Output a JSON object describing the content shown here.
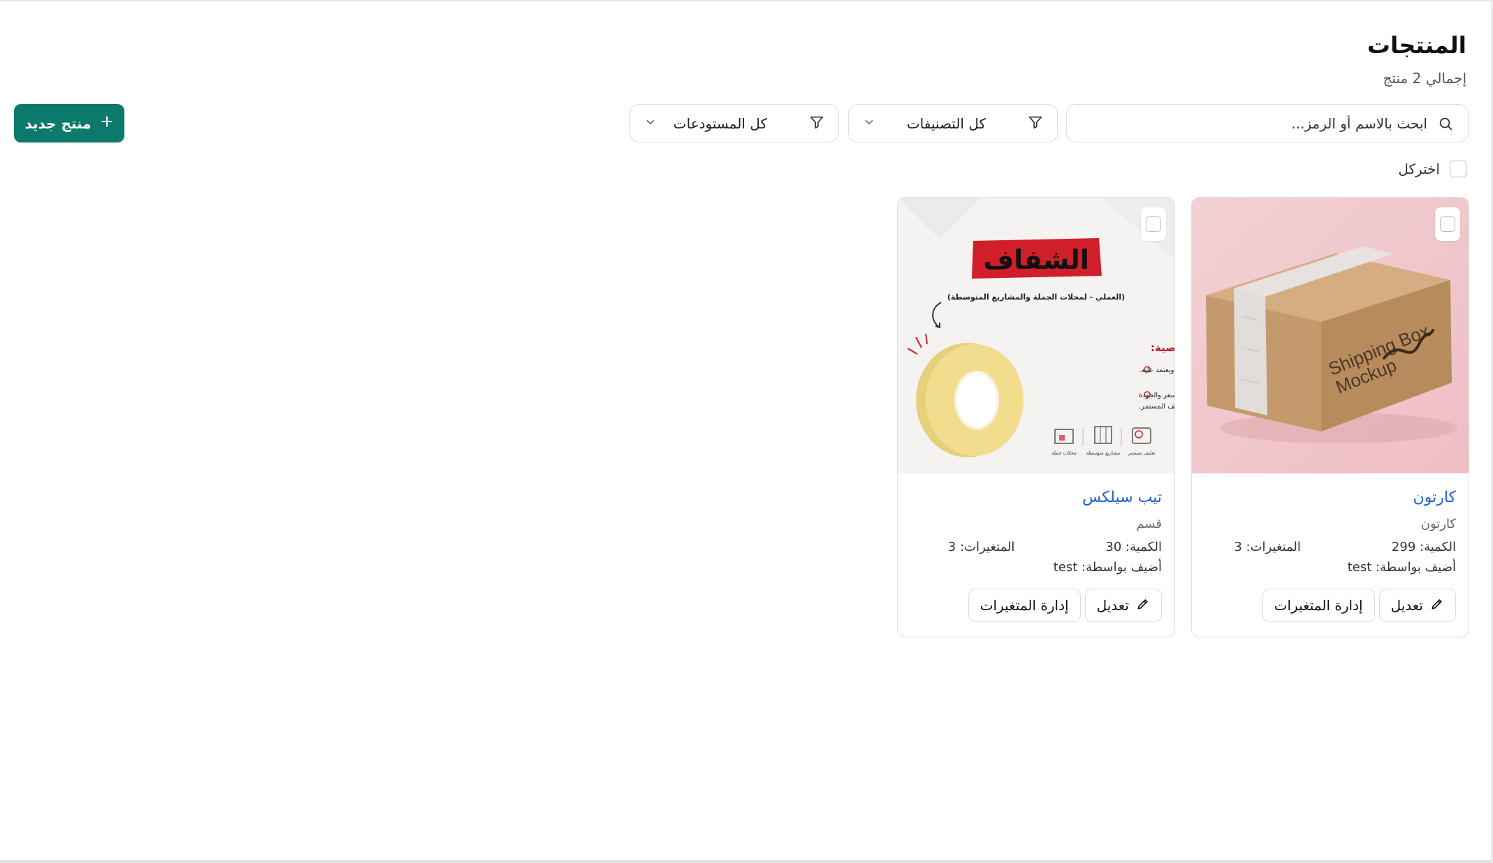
{
  "header": {
    "title": "المنتجات",
    "subtitle": "إجمالي 2 منتج"
  },
  "search": {
    "placeholder": "ابحث بالاسم أو الرمز...",
    "value": ""
  },
  "filters": {
    "categories": "كل التصنيفات",
    "warehouses": "كل المستودعات"
  },
  "new_product_button": "منتج جديد",
  "select_all_label": "اختركل",
  "labels": {
    "quantity": "الكمية:",
    "variants": "المتغيرات:",
    "added_by": "أضيف بواسطة:",
    "edit": "تعديل",
    "manage_variants": "إدارة المتغيرات"
  },
  "products": [
    {
      "name": "كارتون",
      "category": "كارتون",
      "quantity": "299",
      "variants": "3",
      "added_by": "test",
      "image_text": {
        "line1": "Shipping Box",
        "line2": "Mockup"
      }
    },
    {
      "name": "تيب سيلكس",
      "category": "قسم",
      "quantity": "30",
      "variants": "3",
      "added_by": "test",
      "image_text": {
        "banner": "الشفاف",
        "subtitle": "(العملي - لمحلات الجملة والمشاريع المتوسطة)",
        "heading": "الشخصية:",
        "point1": "اقتصادي، سريع، ويعتمد عليه.",
        "point2a": "التوازن المثالي بين السعر والجودة",
        "point2b": "العالية للتغليف المستمر.",
        "icon1": "تغليف مستمر",
        "icon2": "مشاريع متوسطة",
        "icon3": "محلات جملة"
      }
    }
  ],
  "colors": {
    "primary": "#0b7a6b",
    "link": "#1d5fd6",
    "banner_red": "#d01f2a"
  }
}
